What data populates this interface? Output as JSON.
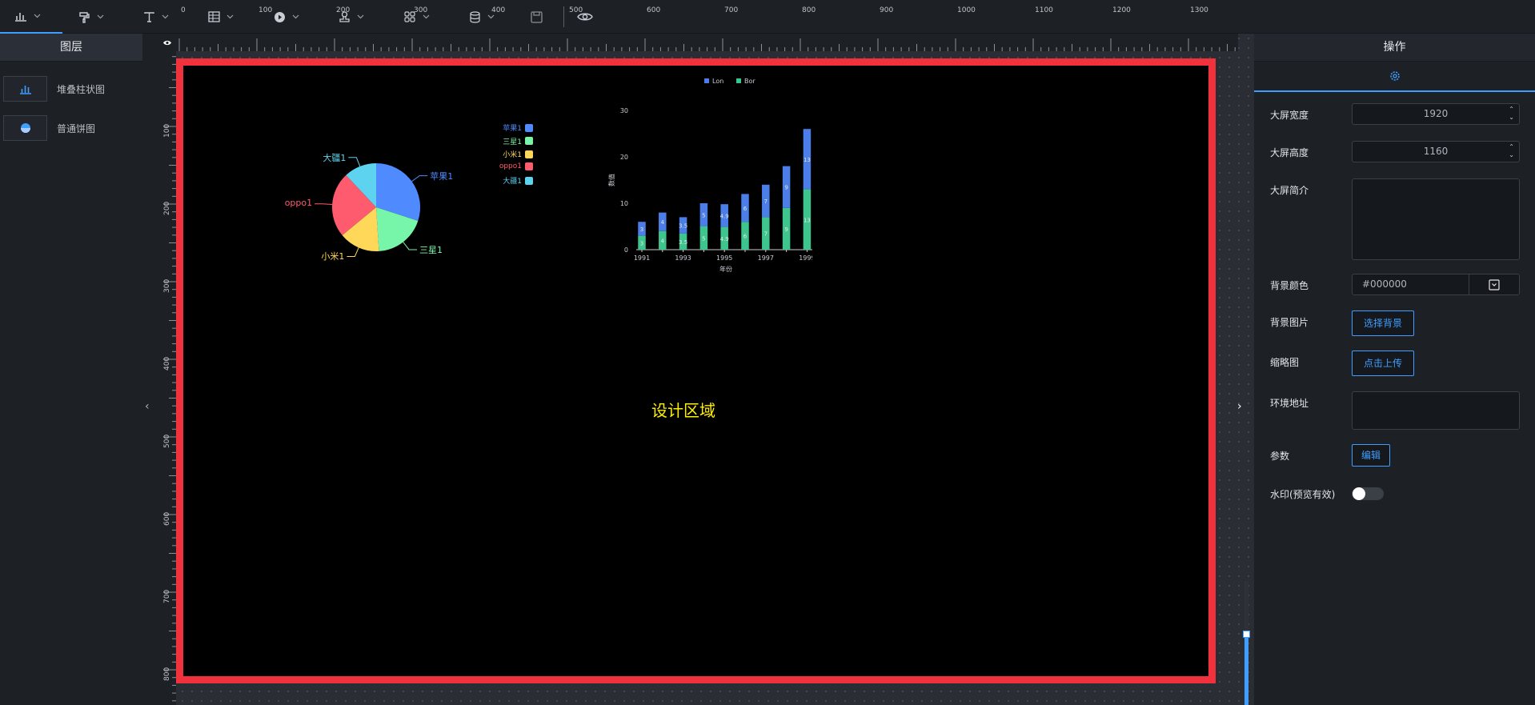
{
  "toolbar": {
    "tools": [
      "chart-icon",
      "paint-icon",
      "text-icon",
      "table-icon",
      "media-icon",
      "stamp-icon",
      "grid-icon",
      "database-icon",
      "save-icon",
      "preview-icon"
    ]
  },
  "layers_panel": {
    "title": "图层",
    "items": [
      {
        "label": "堆叠柱状图",
        "icon": "bar-chart-icon"
      },
      {
        "label": "普通饼图",
        "icon": "pie-chart-icon"
      }
    ]
  },
  "rulers": {
    "h_labels": [
      "0",
      "100",
      "200",
      "300",
      "400",
      "500",
      "600",
      "700",
      "800",
      "900",
      "1000",
      "1100",
      "1200",
      "1300"
    ],
    "v_labels": [
      "100",
      "200",
      "300",
      "400",
      "500",
      "600",
      "700",
      "800"
    ]
  },
  "canvas": {
    "design_label": "设计区域",
    "background": "#000000",
    "frame_color": "#f1313b"
  },
  "pie_chart": {
    "chart_data": {
      "type": "pie",
      "slices": [
        {
          "name": "苹果1",
          "value": 30,
          "color": "#4f8bff"
        },
        {
          "name": "三星1",
          "value": 19,
          "color": "#77f5a8"
        },
        {
          "name": "小米1",
          "value": 15,
          "color": "#ffd85a"
        },
        {
          "name": "oppo1",
          "value": 24,
          "color": "#ff5b6e"
        },
        {
          "name": "大疆1",
          "value": 12,
          "color": "#5ed3ef"
        }
      ],
      "legend": [
        "苹果1",
        "三星1",
        "小米1",
        "oppo1",
        "大疆1"
      ]
    }
  },
  "bar_chart": {
    "chart_data": {
      "type": "bar",
      "stacked": true,
      "categories": [
        "1991",
        "1992",
        "1993",
        "1994",
        "1995",
        "1996",
        "1997",
        "1998",
        "1999"
      ],
      "x_tick_labels": [
        "1991",
        "1993",
        "1995",
        "1997",
        "1999"
      ],
      "xlabel": "年份",
      "ylabel": "数值",
      "ylim": [
        0,
        30
      ],
      "y_ticks": [
        "0",
        "10",
        "20",
        "30"
      ],
      "series": [
        {
          "name": "Lon",
          "color": "#4b7ee8",
          "values": [
            3,
            4,
            3.5,
            5,
            4.9,
            6,
            7,
            9,
            13
          ]
        },
        {
          "name": "Bor",
          "color": "#3dc58d",
          "values": [
            3,
            4,
            3.5,
            5,
            4.9,
            6,
            7,
            9,
            13
          ]
        }
      ],
      "data_labels": [
        "3",
        "4",
        "3.5",
        "5",
        "4.9",
        "6",
        "7",
        "9",
        "13"
      ]
    }
  },
  "ops_panel": {
    "title": "操作",
    "width_label": "大屏宽度",
    "width_value": "1920",
    "height_label": "大屏高度",
    "height_value": "1160",
    "desc_label": "大屏简介",
    "bg_color_label": "背景颜色",
    "bg_color_value": "#000000",
    "bg_image_label": "背景图片",
    "bg_image_button": "选择背景",
    "thumb_label": "缩略图",
    "thumb_button": "点击上传",
    "env_label": "环境地址",
    "params_label": "参数",
    "params_button": "编辑",
    "watermark_label": "水印(预览有效)",
    "watermark_on": false
  }
}
